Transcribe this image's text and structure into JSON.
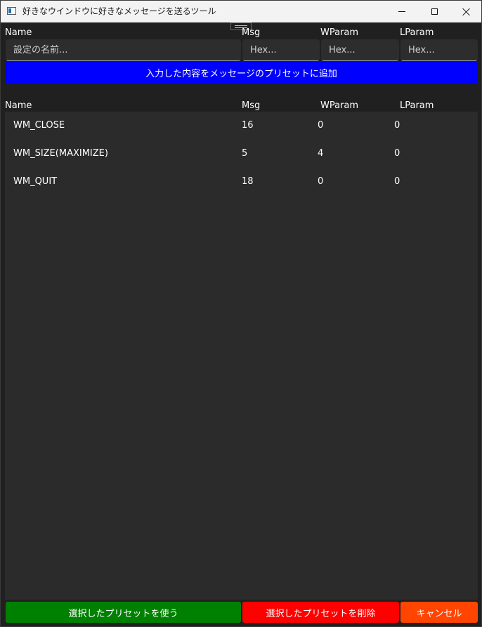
{
  "window": {
    "title": "好きなウインドウに好きなメッセージを送るツール",
    "minimize_icon": "minimize-icon",
    "maximize_icon": "maximize-icon",
    "close_icon": "close-icon"
  },
  "form": {
    "headers": {
      "name": "Name",
      "msg": "Msg",
      "wparam": "WParam",
      "lparam": "LParam"
    },
    "name_placeholder": "設定の名前...",
    "msg_placeholder": "Hex...",
    "wparam_placeholder": "Hex...",
    "lparam_placeholder": "Hex...",
    "add_button_label": "入力した内容をメッセージのプリセットに追加",
    "add_button_color": "#0000ff"
  },
  "presets": {
    "headers": {
      "name": "Name",
      "msg": "Msg",
      "wparam": "WParam",
      "lparam": "LParam"
    },
    "rows": [
      {
        "name": "WM_CLOSE",
        "msg": "16",
        "wparam": "0",
        "lparam": "0"
      },
      {
        "name": "WM_SIZE(MAXIMIZE)",
        "msg": "5",
        "wparam": "4",
        "lparam": "0"
      },
      {
        "name": "WM_QUIT",
        "msg": "18",
        "wparam": "0",
        "lparam": "0"
      }
    ]
  },
  "actions": {
    "use_label": "選択したプリセットを使う",
    "delete_label": "選択したプリセットを削除",
    "cancel_label": "キャンセル",
    "use_color": "#008000",
    "delete_color": "#ff0000",
    "cancel_color": "#ff4500"
  }
}
